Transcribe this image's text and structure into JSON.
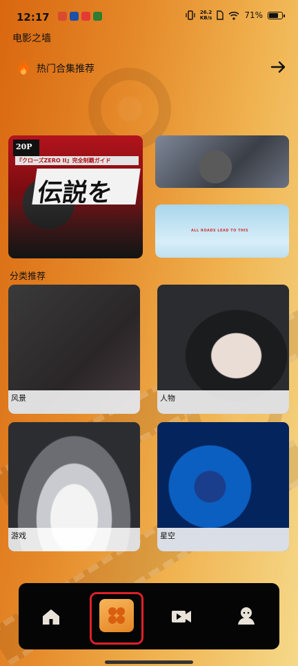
{
  "status_bar": {
    "time": "12:17",
    "net_speed": "26.2",
    "net_unit": "KB/s",
    "battery_percent": "71%"
  },
  "page": {
    "title": "电影之墙"
  },
  "hot_collections": {
    "label": "热门合集推荐"
  },
  "featured_posters": [
    {
      "id": "poster-main",
      "badge_text": "20P",
      "headline": "『クローズZERO II』完全制覇ガイド",
      "big_text": "伝説を"
    },
    {
      "id": "poster-top-right"
    },
    {
      "id": "poster-mid-right",
      "caption": "ALL ROADS LEAD TO THIS"
    }
  ],
  "category_section": {
    "title": "分类推荐",
    "items": [
      {
        "label": "风景"
      },
      {
        "label": "人物"
      },
      {
        "label": "游戏"
      },
      {
        "label": "星空"
      }
    ]
  },
  "tab_bar": {
    "tabs": [
      {
        "name": "home",
        "icon": "home-icon",
        "selected": false
      },
      {
        "name": "category",
        "icon": "grid-icon",
        "selected": true
      },
      {
        "name": "video",
        "icon": "video-camera-icon",
        "selected": false
      },
      {
        "name": "profile",
        "icon": "profile-icon",
        "selected": false
      }
    ]
  },
  "colors": {
    "accent_orange": "#e58524",
    "highlight_red": "#e0202a",
    "tab_bar_bg": "#050505"
  }
}
